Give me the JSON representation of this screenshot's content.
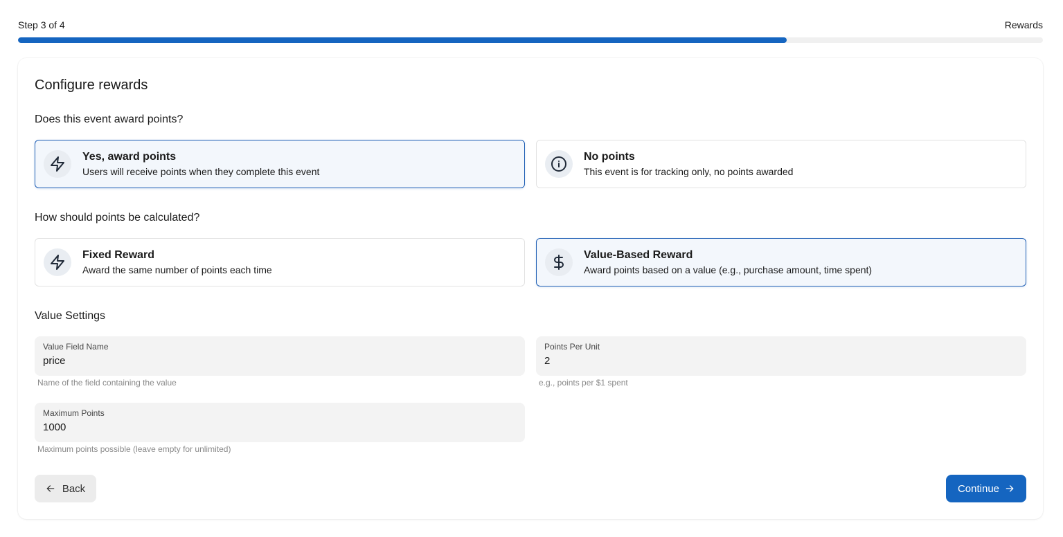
{
  "header": {
    "step_text": "Step 3 of 4",
    "step_name": "Rewards",
    "progress_fraction": 0.75,
    "accent_color": "#1565c0"
  },
  "card": {
    "title": "Configure rewards"
  },
  "award_section": {
    "question": "Does this event award points?",
    "options": [
      {
        "icon": "lightning-icon",
        "title": "Yes, award points",
        "description": "Users will receive points when they complete this event",
        "selected": true
      },
      {
        "icon": "info-icon",
        "title": "No points",
        "description": "This event is for tracking only, no points awarded",
        "selected": false
      }
    ]
  },
  "calc_section": {
    "question": "How should points be calculated?",
    "options": [
      {
        "icon": "lightning-icon",
        "title": "Fixed Reward",
        "description": "Award the same number of points each time",
        "selected": false
      },
      {
        "icon": "dollar-icon",
        "title": "Value-Based Reward",
        "description": "Award points based on a value (e.g., purchase amount, time spent)",
        "selected": true
      }
    ]
  },
  "value_settings": {
    "title": "Value Settings",
    "fields": {
      "value_field_name": {
        "label": "Value Field Name",
        "value": "price",
        "helper": "Name of the field containing the value"
      },
      "points_per_unit": {
        "label": "Points Per Unit",
        "value": "2",
        "helper": "e.g., points per $1 spent"
      },
      "maximum_points": {
        "label": "Maximum Points",
        "value": "1000",
        "helper": "Maximum points possible (leave empty for unlimited)"
      }
    }
  },
  "actions": {
    "back_label": "Back",
    "back_icon": "arrow-left-icon",
    "continue_label": "Continue",
    "continue_icon": "arrow-right-icon"
  }
}
